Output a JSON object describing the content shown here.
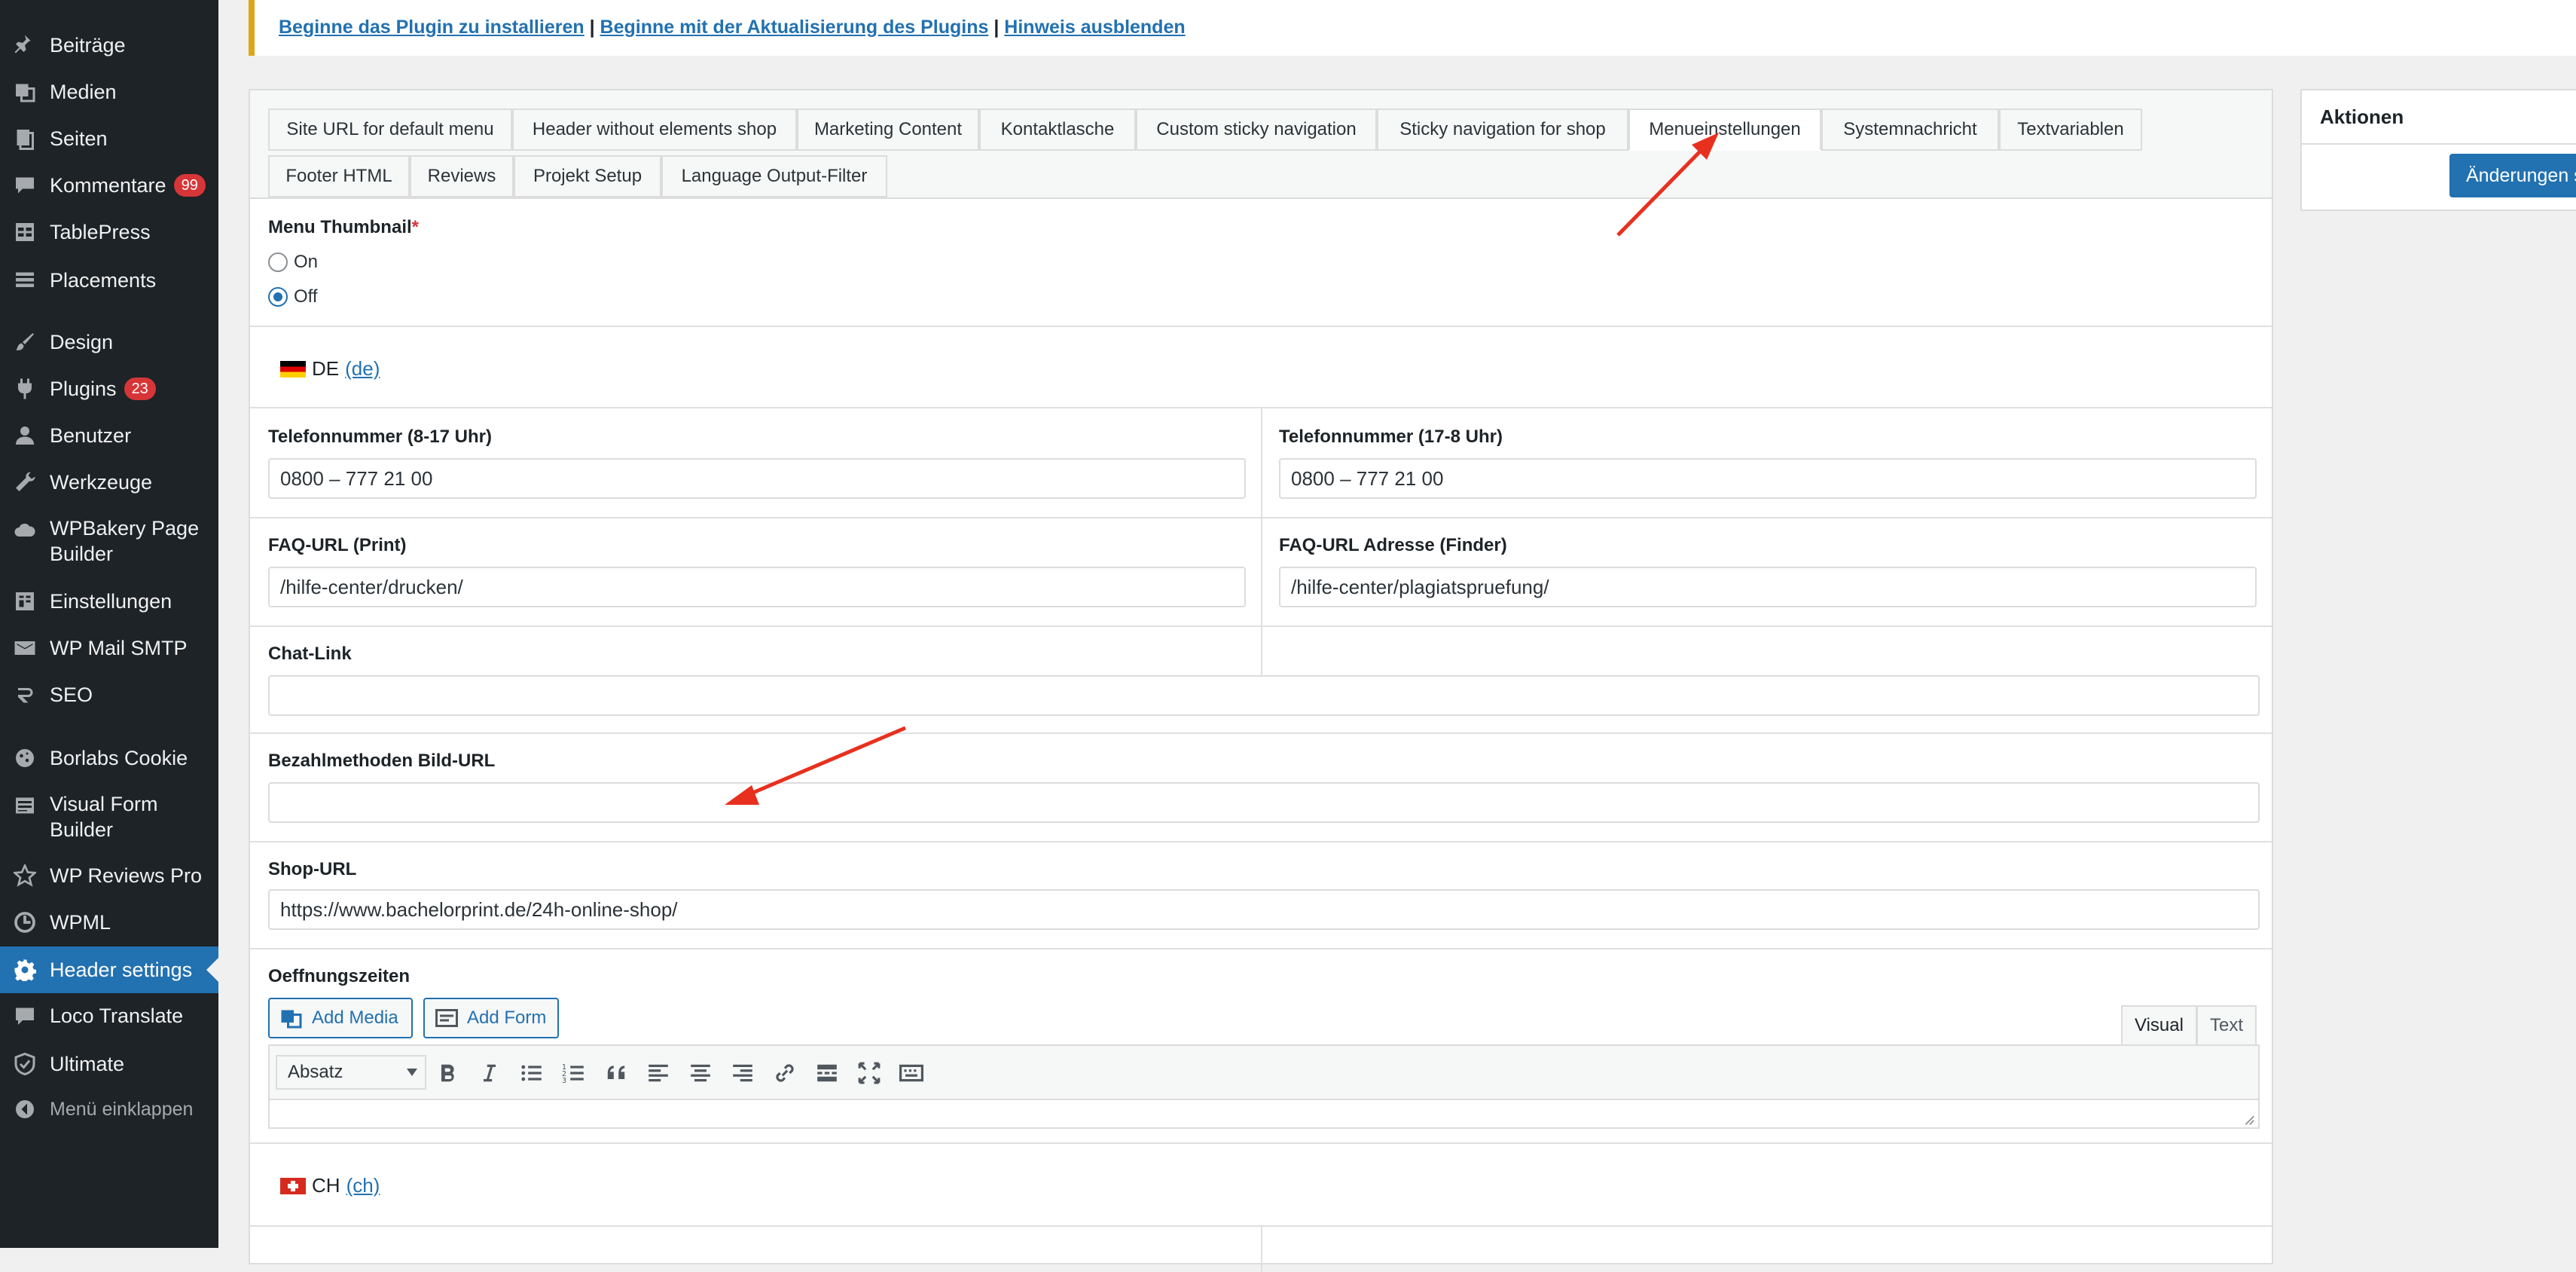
{
  "sidebar": {
    "items": [
      {
        "label": "Beiträge",
        "icon": "pin-icon"
      },
      {
        "label": "Medien",
        "icon": "media-icon"
      },
      {
        "label": "Seiten",
        "icon": "pages-icon"
      },
      {
        "label": "Kommentare",
        "icon": "comment-icon",
        "badge": "99"
      },
      {
        "label": "TablePress",
        "icon": "table-icon"
      },
      {
        "label": "Placements",
        "icon": "placements-icon"
      },
      {
        "label": "Design",
        "icon": "brush-icon"
      },
      {
        "label": "Plugins",
        "icon": "plugin-icon",
        "badge": "23"
      },
      {
        "label": "Benutzer",
        "icon": "user-icon"
      },
      {
        "label": "Werkzeuge",
        "icon": "wrench-icon"
      },
      {
        "label": "WPBakery Page Builder",
        "icon": "cloud-icon"
      },
      {
        "label": "Einstellungen",
        "icon": "settings-icon"
      },
      {
        "label": "WP Mail SMTP",
        "icon": "mail-icon"
      },
      {
        "label": "SEO",
        "icon": "seo-icon"
      },
      {
        "label": "Borlabs Cookie",
        "icon": "cookie-icon"
      },
      {
        "label": "Visual Form Builder",
        "icon": "form-icon"
      },
      {
        "label": "WP Reviews Pro",
        "icon": "star-icon"
      },
      {
        "label": "WPML",
        "icon": "wpml-icon"
      },
      {
        "label": "Header settings",
        "icon": "gear-icon",
        "active": true
      },
      {
        "label": "Loco Translate",
        "icon": "translate-icon"
      },
      {
        "label": "Ultimate",
        "icon": "shield-icon"
      },
      {
        "label": "Menü einklappen",
        "icon": "collapse-icon"
      }
    ]
  },
  "notice": {
    "link1": "Beginne das Plugin zu installieren",
    "sep": "|",
    "link2": "Beginne mit der Aktualisierung des Plugins",
    "link3": "Hinweis ausblenden"
  },
  "tabs": [
    "Site URL for default menu",
    "Header without elements shop",
    "Marketing Content",
    "Kontaktlasche",
    "Custom sticky navigation",
    "Sticky navigation for shop",
    "Menueinstellungen",
    "Systemnachricht",
    "Textvariablen",
    "Footer HTML",
    "Reviews",
    "Projekt Setup",
    "Language Output-Filter"
  ],
  "active_tab": "Menueinstellungen",
  "form": {
    "menu_thumbnail": {
      "label": "Menu Thumbnail",
      "required": "*",
      "options": [
        "On",
        "Off"
      ],
      "selected": "Off"
    },
    "lang_de": {
      "code": "DE",
      "link": "(de)"
    },
    "phone_day": {
      "label": "Telefonnummer (8-17 Uhr)",
      "value": "0800 – 777 21 00"
    },
    "phone_night": {
      "label": "Telefonnummer (17-8 Uhr)",
      "value": "0800 – 777 21 00"
    },
    "faq_print": {
      "label": "FAQ-URL (Print)",
      "value": "/hilfe-center/drucken/"
    },
    "faq_finder": {
      "label": "FAQ-URL Adresse (Finder)",
      "value": "/hilfe-center/plagiatspruefung/"
    },
    "chat_link": {
      "label": "Chat-Link",
      "value": ""
    },
    "payment_img": {
      "label": "Bezahlmethoden Bild-URL",
      "value": ""
    },
    "shop_url": {
      "label": "Shop-URL",
      "value": "https://www.bachelorprint.de/24h-online-shop/"
    },
    "opening_hours": {
      "label": "Oeffnungszeiten"
    },
    "lang_ch": {
      "code": "CH",
      "link": "(ch)"
    }
  },
  "editor": {
    "add_media": "Add Media",
    "add_form": "Add Form",
    "tab_visual": "Visual",
    "tab_text": "Text",
    "format": "Absatz"
  },
  "actions": {
    "title": "Aktionen",
    "save": "Änderungen speichern"
  },
  "colors": {
    "accent": "#2271b1",
    "sidebar": "#1d2327",
    "badge": "#d63638",
    "notice_border": "#dba617",
    "arrow": "#e8301f"
  }
}
